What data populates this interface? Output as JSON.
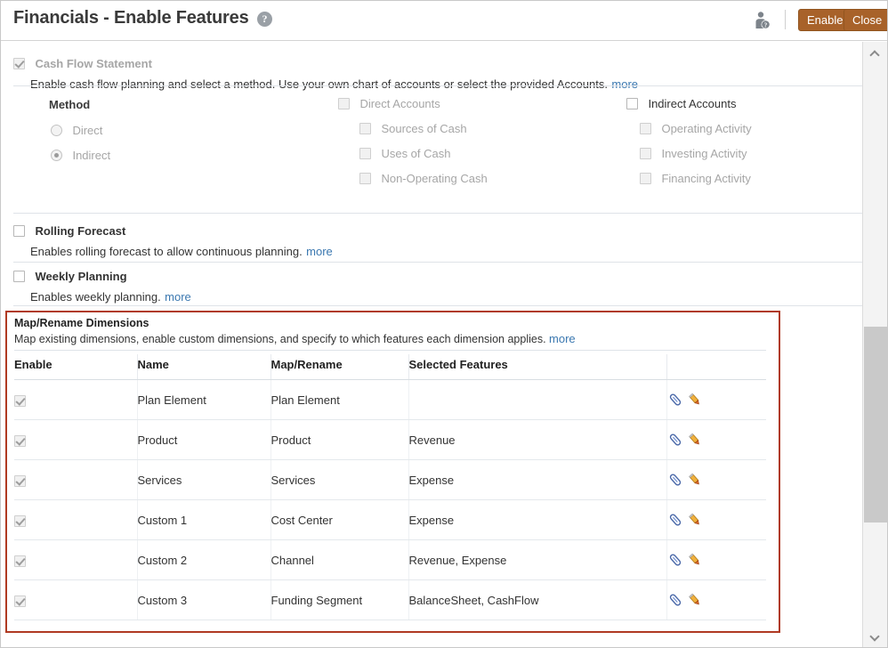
{
  "header": {
    "title": "Financials - Enable Features",
    "help_glyph": "?",
    "user_icon": "user-help-icon",
    "enable_label": "Enable",
    "close_label": "Close",
    "button_color": "#a8622a"
  },
  "features": {
    "cash_flow": {
      "label": "Cash Flow Statement",
      "checked": true,
      "disabled": true,
      "description": "Enable cash flow planning and select a method. Use your own chart of accounts or select the provided Accounts.",
      "more": "more",
      "method_heading": "Method",
      "method_options": [
        {
          "label": "Direct",
          "selected": false,
          "disabled": true
        },
        {
          "label": "Indirect",
          "selected": true,
          "disabled": true
        }
      ],
      "direct_accounts": {
        "label": "Direct Accounts",
        "checked": false,
        "disabled": true,
        "children": [
          {
            "label": "Sources of Cash",
            "checked": false,
            "disabled": true
          },
          {
            "label": "Uses of Cash",
            "checked": false,
            "disabled": true
          },
          {
            "label": "Non-Operating Cash",
            "checked": false,
            "disabled": true
          }
        ]
      },
      "indirect_accounts": {
        "label": "Indirect Accounts",
        "checked": false,
        "disabled": false,
        "children": [
          {
            "label": "Operating Activity",
            "checked": false,
            "disabled": true
          },
          {
            "label": "Investing Activity",
            "checked": false,
            "disabled": true
          },
          {
            "label": "Financing Activity",
            "checked": false,
            "disabled": true
          }
        ]
      }
    },
    "rolling_forecast": {
      "label": "Rolling Forecast",
      "checked": false,
      "description": "Enables rolling forecast to allow continuous planning.",
      "more": "more"
    },
    "weekly_planning": {
      "label": "Weekly Planning",
      "checked": false,
      "description": "Enables weekly planning.",
      "more": "more"
    }
  },
  "map_rename": {
    "title": "Map/Rename Dimensions",
    "description": "Map existing dimensions, enable custom dimensions, and specify to which features each dimension applies.",
    "more": "more",
    "highlight_color": "#b03a22",
    "columns": [
      "Enable",
      "Name",
      "Map/Rename",
      "Selected Features"
    ],
    "rows": [
      {
        "enabled": true,
        "name": "Plan Element",
        "map": "Plan Element",
        "features": ""
      },
      {
        "enabled": true,
        "name": "Product",
        "map": "Product",
        "features": "Revenue"
      },
      {
        "enabled": true,
        "name": "Services",
        "map": "Services",
        "features": "Expense"
      },
      {
        "enabled": true,
        "name": "Custom 1",
        "map": "Cost Center",
        "features": "Expense"
      },
      {
        "enabled": true,
        "name": "Custom 2",
        "map": "Channel",
        "features": "Revenue, Expense"
      },
      {
        "enabled": true,
        "name": "Custom 3",
        "map": "Funding Segment",
        "features": "BalanceSheet, CashFlow"
      }
    ],
    "row_actions": [
      "attach-icon",
      "edit-pencil-icon"
    ]
  },
  "scrollbar": {
    "up_icon": "chevron-up-icon",
    "down_icon": "chevron-down-icon",
    "thumb": "scroll-thumb"
  }
}
